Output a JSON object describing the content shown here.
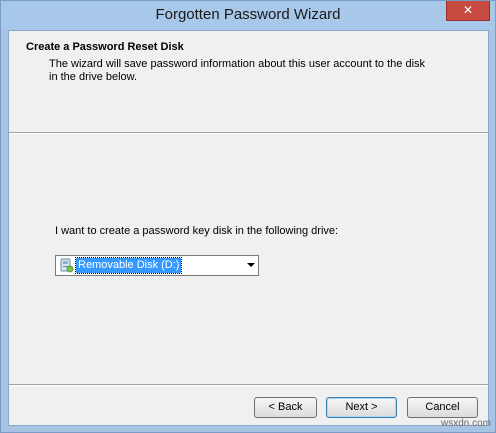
{
  "window": {
    "title": "Forgotten Password Wizard",
    "close_glyph": "✕"
  },
  "header": {
    "title": "Create a Password Reset Disk",
    "description": "The wizard will save password information about this user account to the disk in the drive below."
  },
  "body": {
    "prompt": "I want to create a password key disk in the following drive:",
    "drive_select": {
      "selected": "Removable Disk (D:)",
      "icon": "removable-drive-icon"
    }
  },
  "buttons": {
    "back": "< Back",
    "next": "Next >",
    "cancel": "Cancel"
  },
  "watermark": "wsxdn.com",
  "colors": {
    "title_bar": "#a8c8ea",
    "close_button": "#c74b40",
    "dialog_bg": "#f0f0f0",
    "selection": "#3399ff"
  }
}
